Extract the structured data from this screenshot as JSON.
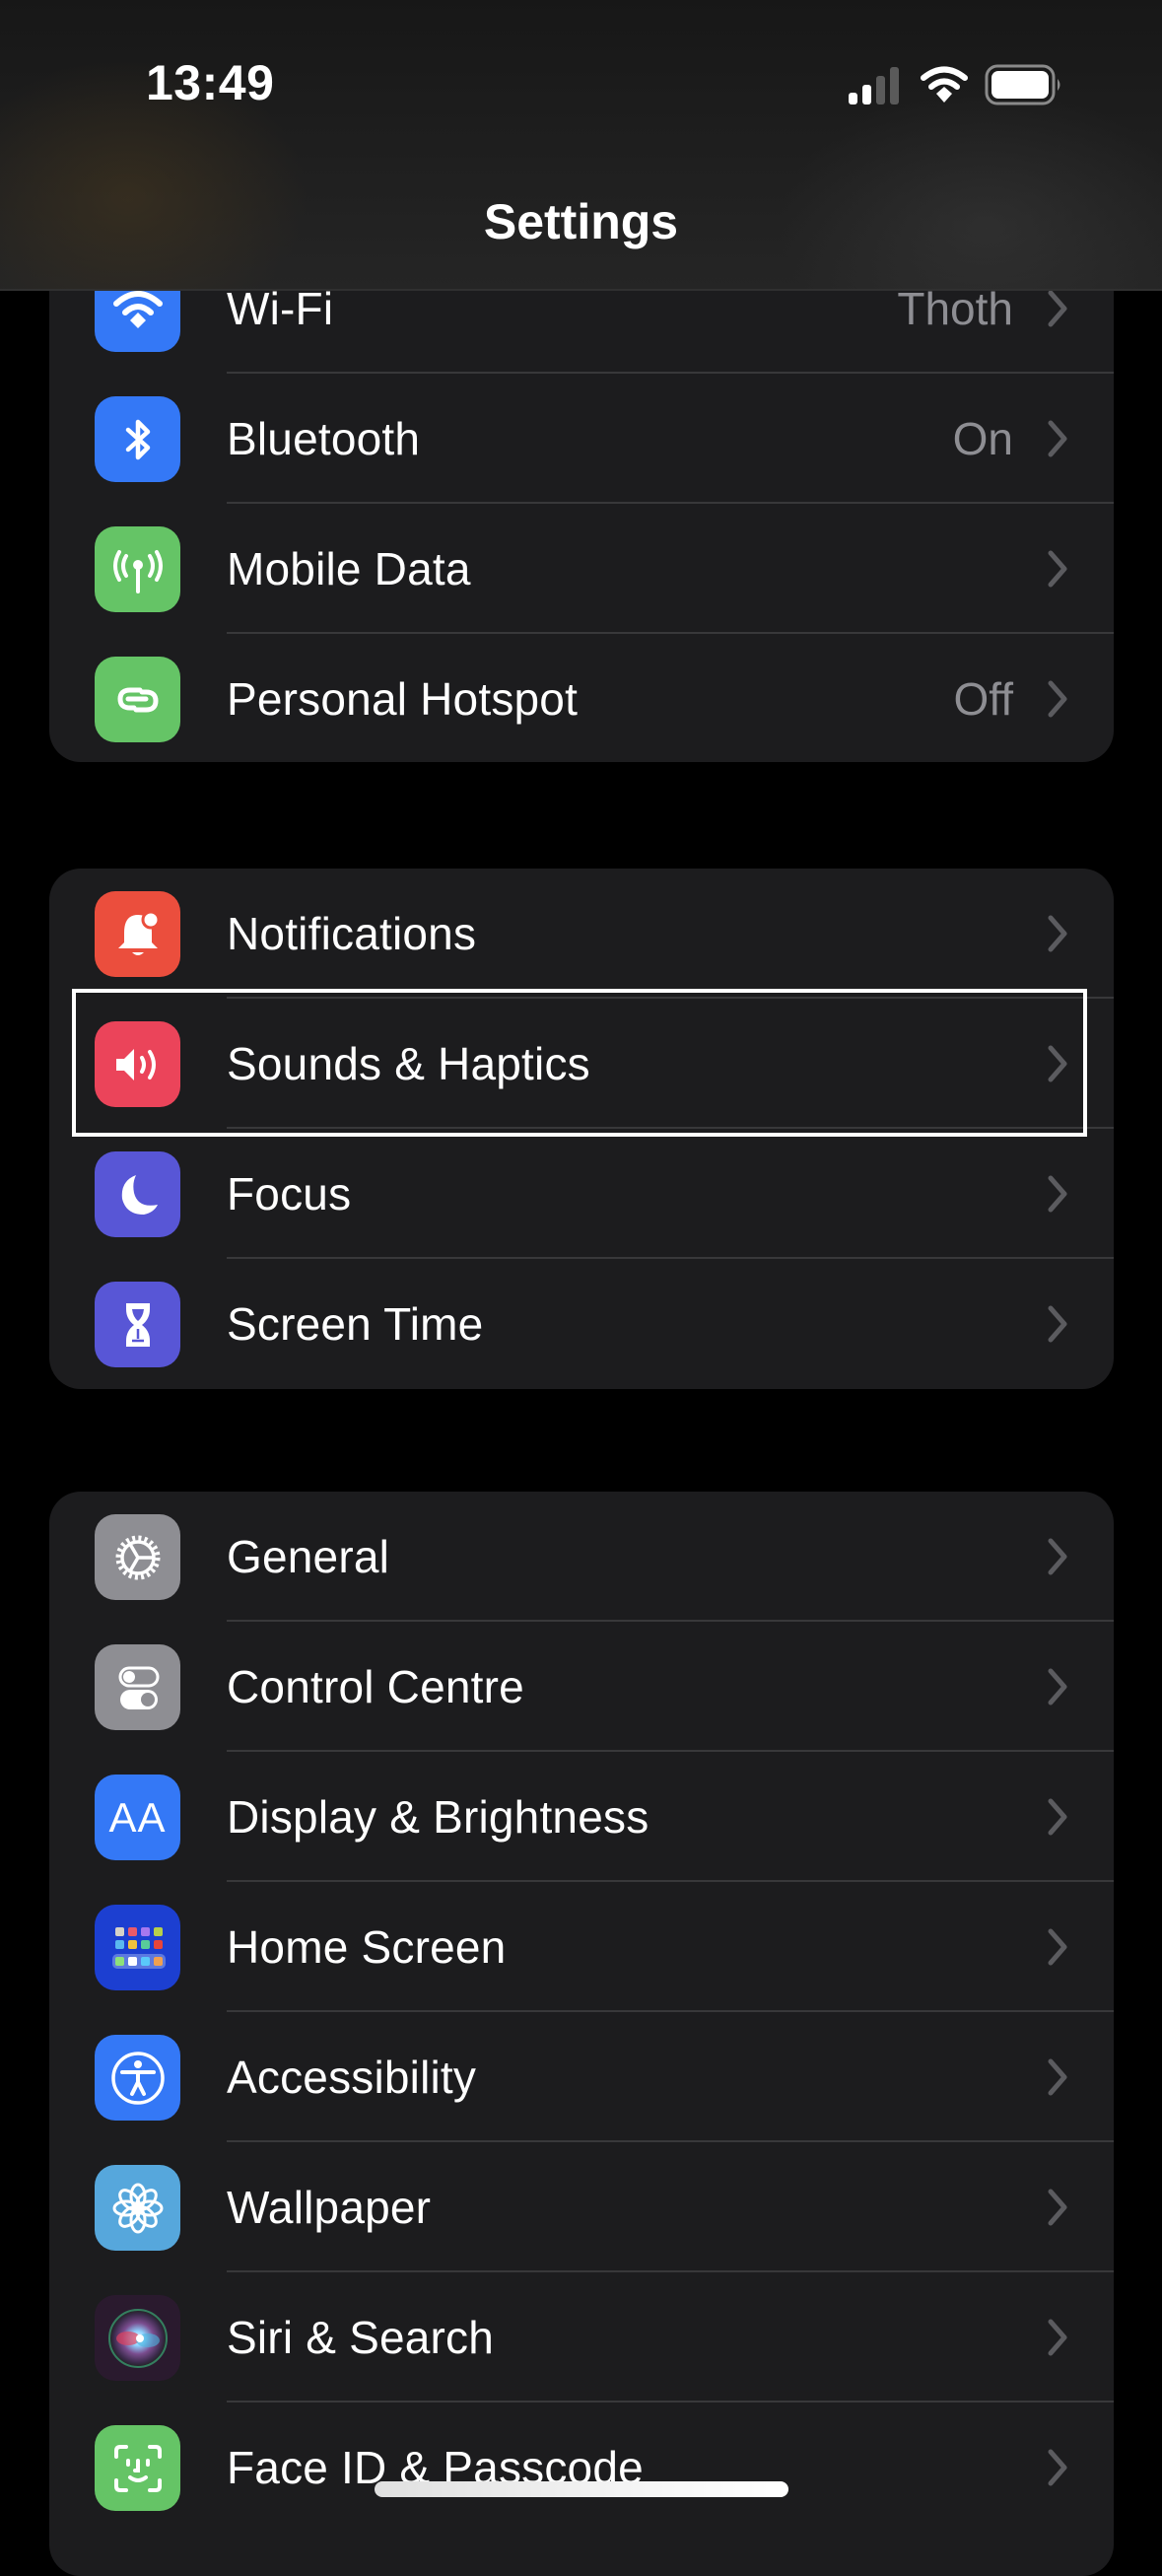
{
  "status_bar": {
    "time": "13:49",
    "icons": [
      "cellular-signal-icon",
      "wifi-icon",
      "battery-icon"
    ],
    "signal_bars_active": 2,
    "signal_bars_total": 4
  },
  "nav": {
    "title": "Settings"
  },
  "groups": [
    {
      "rows": [
        {
          "label": "Wi-Fi",
          "value": "Thoth",
          "icon": "wifi-icon",
          "color": "#3478f6"
        },
        {
          "label": "Bluetooth",
          "value": "On",
          "icon": "bluetooth-icon",
          "color": "#3478f6"
        },
        {
          "label": "Mobile Data",
          "value": "",
          "icon": "antenna-icon",
          "color": "#65c466"
        },
        {
          "label": "Personal Hotspot",
          "value": "Off",
          "icon": "hotspot-link-icon",
          "color": "#65c466"
        }
      ]
    },
    {
      "rows": [
        {
          "label": "Notifications",
          "value": "",
          "icon": "bell-icon",
          "color": "#eb4e3d"
        },
        {
          "label": "Sounds & Haptics",
          "value": "",
          "icon": "speaker-icon",
          "color": "#eb445a",
          "highlighted": true
        },
        {
          "label": "Focus",
          "value": "",
          "icon": "moon-icon",
          "color": "#5856d6"
        },
        {
          "label": "Screen Time",
          "value": "",
          "icon": "hourglass-icon",
          "color": "#5856d6"
        }
      ]
    },
    {
      "rows": [
        {
          "label": "General",
          "value": "",
          "icon": "gear-icon",
          "color": "#8e8e93"
        },
        {
          "label": "Control Centre",
          "value": "",
          "icon": "toggles-icon",
          "color": "#8e8e93"
        },
        {
          "label": "Display & Brightness",
          "value": "",
          "icon": "text-size-icon",
          "color": "#3478f6"
        },
        {
          "label": "Home Screen",
          "value": "",
          "icon": "app-grid-icon",
          "color": "#1c3fd1"
        },
        {
          "label": "Accessibility",
          "value": "",
          "icon": "accessibility-icon",
          "color": "#3478f6"
        },
        {
          "label": "Wallpaper",
          "value": "",
          "icon": "flower-icon",
          "color": "#56a7dc"
        },
        {
          "label": "Siri & Search",
          "value": "",
          "icon": "siri-icon",
          "color": "#2a1a2e"
        },
        {
          "label": "Face ID & Passcode",
          "value": "",
          "icon": "face-id-icon",
          "color": "#65c466"
        }
      ]
    }
  ],
  "display_brightness_icon_text": "AA"
}
